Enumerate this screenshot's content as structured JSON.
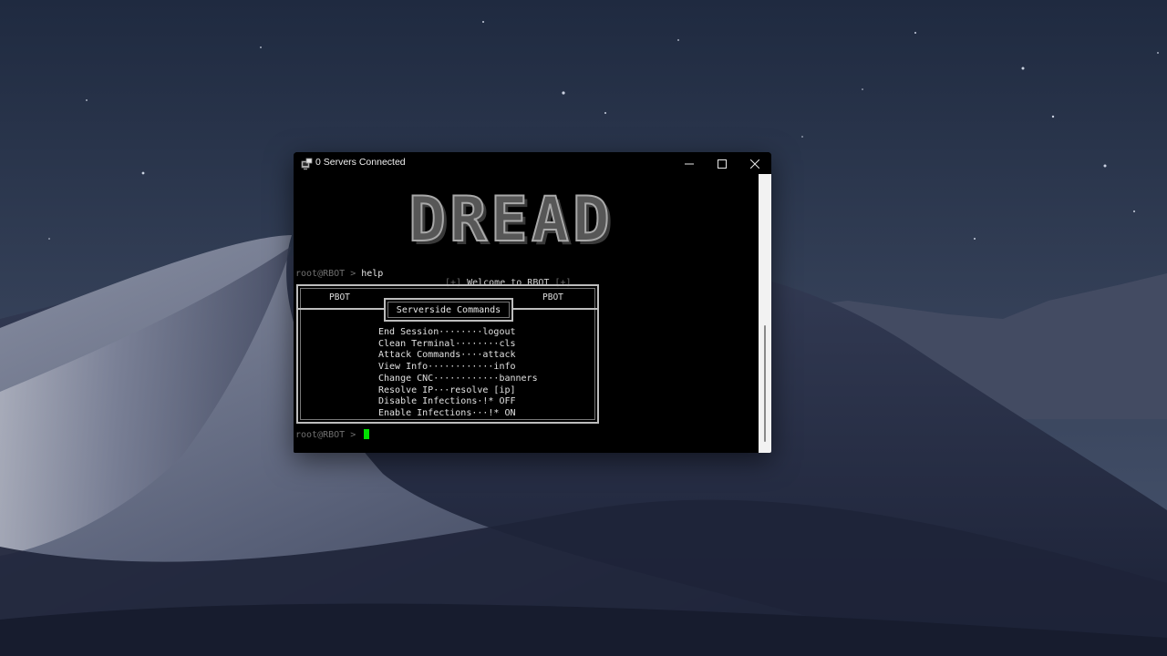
{
  "window": {
    "title": "0 Servers Connected"
  },
  "terminal": {
    "banner": "DREAD",
    "welcome": {
      "left": "[+]",
      "text": " Welcome to RBOT ",
      "right": "[+]"
    },
    "prompt": "root@RBOT > ",
    "command": "help",
    "prompt2": "root@RBOT > ",
    "help_box": {
      "tag_left": "PBOT",
      "tag_right": "PBOT",
      "title": "Serverside Commands",
      "commands": [
        "End Session········logout",
        "Clean Terminal········cls",
        "Attack Commands····attack",
        "View Info············info",
        "Change CNC············banners",
        "Resolve IP···resolve [ip]",
        "Disable Infections·!* OFF",
        "Enable Infections···!* ON"
      ]
    }
  },
  "colors": {
    "cursor": "#00e000",
    "terminal_bg": "#000000"
  },
  "icons": {
    "window_icon": "terminal-network-icon",
    "minimize": "minimize-icon",
    "maximize": "maximize-icon",
    "close": "close-icon"
  }
}
